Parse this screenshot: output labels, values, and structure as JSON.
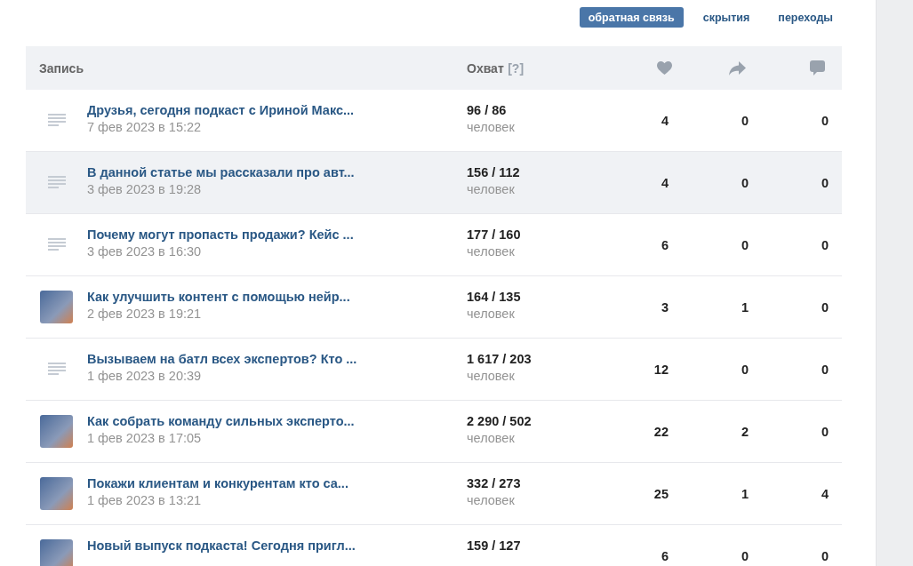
{
  "tabs": [
    {
      "label": "обратная связь",
      "selected": true
    },
    {
      "label": "скрытия",
      "selected": false
    },
    {
      "label": "переходы",
      "selected": false
    }
  ],
  "table": {
    "columns": {
      "post": "Запись",
      "reach": "Охват",
      "reach_hint": "[?]"
    },
    "rows": [
      {
        "kind": "text",
        "title": "Друзья, сегодня подкаст с Ириной Макс...",
        "date": "7 фев 2023 в 15:22",
        "reach": "96 / 86",
        "reach_unit": "человек",
        "likes": "4",
        "shares": "0",
        "comments": "0",
        "highlighted": false
      },
      {
        "kind": "text",
        "title": "В данной статье мы рассказали про авт...",
        "date": "3 фев 2023 в 19:28",
        "reach": "156 / 112",
        "reach_unit": "человек",
        "likes": "4",
        "shares": "0",
        "comments": "0",
        "highlighted": true
      },
      {
        "kind": "text",
        "title": "Почему могут пропасть продажи? Кейс ...",
        "date": "3 фев 2023 в 16:30",
        "reach": "177 / 160",
        "reach_unit": "человек",
        "likes": "6",
        "shares": "0",
        "comments": "0",
        "highlighted": false
      },
      {
        "kind": "photo",
        "title": "Как улучшить контент с помощью нейр...",
        "date": "2 фев 2023 в 19:21",
        "reach": "164 / 135",
        "reach_unit": "человек",
        "likes": "3",
        "shares": "1",
        "comments": "0",
        "highlighted": false
      },
      {
        "kind": "text",
        "title": "Вызываем на батл всех экспертов? Кто ...",
        "date": "1 фев 2023 в 20:39",
        "reach": "1 617 / 203",
        "reach_unit": "человек",
        "likes": "12",
        "shares": "0",
        "comments": "0",
        "highlighted": false
      },
      {
        "kind": "photo",
        "title": "Как собрать команду сильных эксперто...",
        "date": "1 фев 2023 в 17:05",
        "reach": "2 290 / 502",
        "reach_unit": "человек",
        "likes": "22",
        "shares": "2",
        "comments": "0",
        "highlighted": false
      },
      {
        "kind": "photo",
        "title": "Покажи клиентам и конкурентам кто са...",
        "date": "1 фев 2023 в 13:21",
        "reach": "332 / 273",
        "reach_unit": "человек",
        "likes": "25",
        "shares": "1",
        "comments": "4",
        "highlighted": false
      },
      {
        "kind": "photo",
        "title": "Новый выпуск подкаста! Сегодня пригл...",
        "reach": "159 / 127",
        "likes": "6",
        "shares": "0",
        "comments": "0",
        "highlighted": false
      }
    ]
  }
}
